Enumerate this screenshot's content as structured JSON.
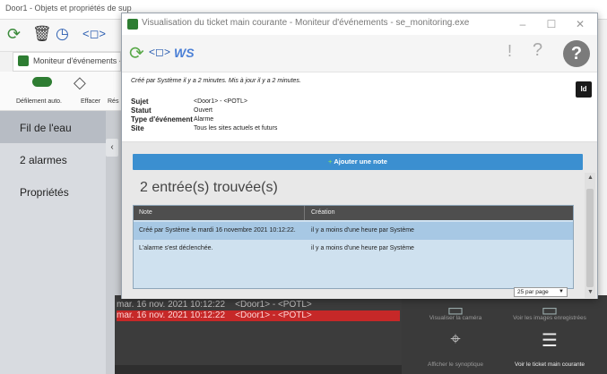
{
  "background_window": {
    "title": "Door1 - Objets et propriétés de sup"
  },
  "moniteur_window": {
    "title": "Moniteur d'événements - se",
    "toolbar": {
      "scroll_label": "Défilement auto.",
      "clear_label": "Effacer",
      "reset_label": "Rés"
    },
    "sidebar": {
      "items": [
        {
          "label": "Fil de l'eau"
        },
        {
          "label": "2 alarmes"
        },
        {
          "label": "Propriétés"
        }
      ]
    },
    "event_rows": [
      {
        "date": "mar. 16 nov. 2021 10:12:22",
        "subject": "<Door1> - <POTL>"
      },
      {
        "date": "mar. 16 nov. 2021 10:12:22",
        "subject": "<Door1> - <POTL>"
      }
    ],
    "actions": [
      {
        "label": "Visualiser la caméra",
        "icon": "camera-icon"
      },
      {
        "label": "Voir les images enregistrées",
        "icon": "recorded-images-icon"
      },
      {
        "label": "Afficher le synoptique",
        "icon": "map-icon"
      },
      {
        "label": "Voir le ticket main courante",
        "icon": "ticket-icon"
      }
    ]
  },
  "dialog": {
    "title": "Visualisation du ticket main courante - Moniteur d'événements - se_monitoring.exe",
    "logo": "WS",
    "help_icon": "?",
    "info_line": "Créé par Système il y a 2 minutes. Mis à jour il y a 2 minutes.",
    "id_badge": "Id",
    "fields": [
      {
        "label": "Sujet",
        "value": "<Door1> - <POTL>"
      },
      {
        "label": "Statut",
        "value": "Ouvert"
      },
      {
        "label": "Type d'événement",
        "value": "Alarme"
      },
      {
        "label": "Site",
        "value": "Tous les sites actuels et futurs"
      }
    ],
    "add_note_label": "Ajouter une note",
    "entries_found": "2 entrée(s) trouvée(s)",
    "table": {
      "headers": [
        "Note",
        "Création"
      ],
      "rows": [
        {
          "note": "Créé par Système le mardi 16 novembre 2021 10:12:22.",
          "creation": "il y a moins d'une heure par Système"
        },
        {
          "note": "L'alarme s'est déclenchée.",
          "creation": "il y a moins d'une heure par Système"
        }
      ]
    },
    "pager": "25 par page"
  },
  "colors": {
    "accent_blue": "#3b8fd0",
    "selected_row": "#a7c8e4",
    "alarm_red": "#c62828"
  }
}
